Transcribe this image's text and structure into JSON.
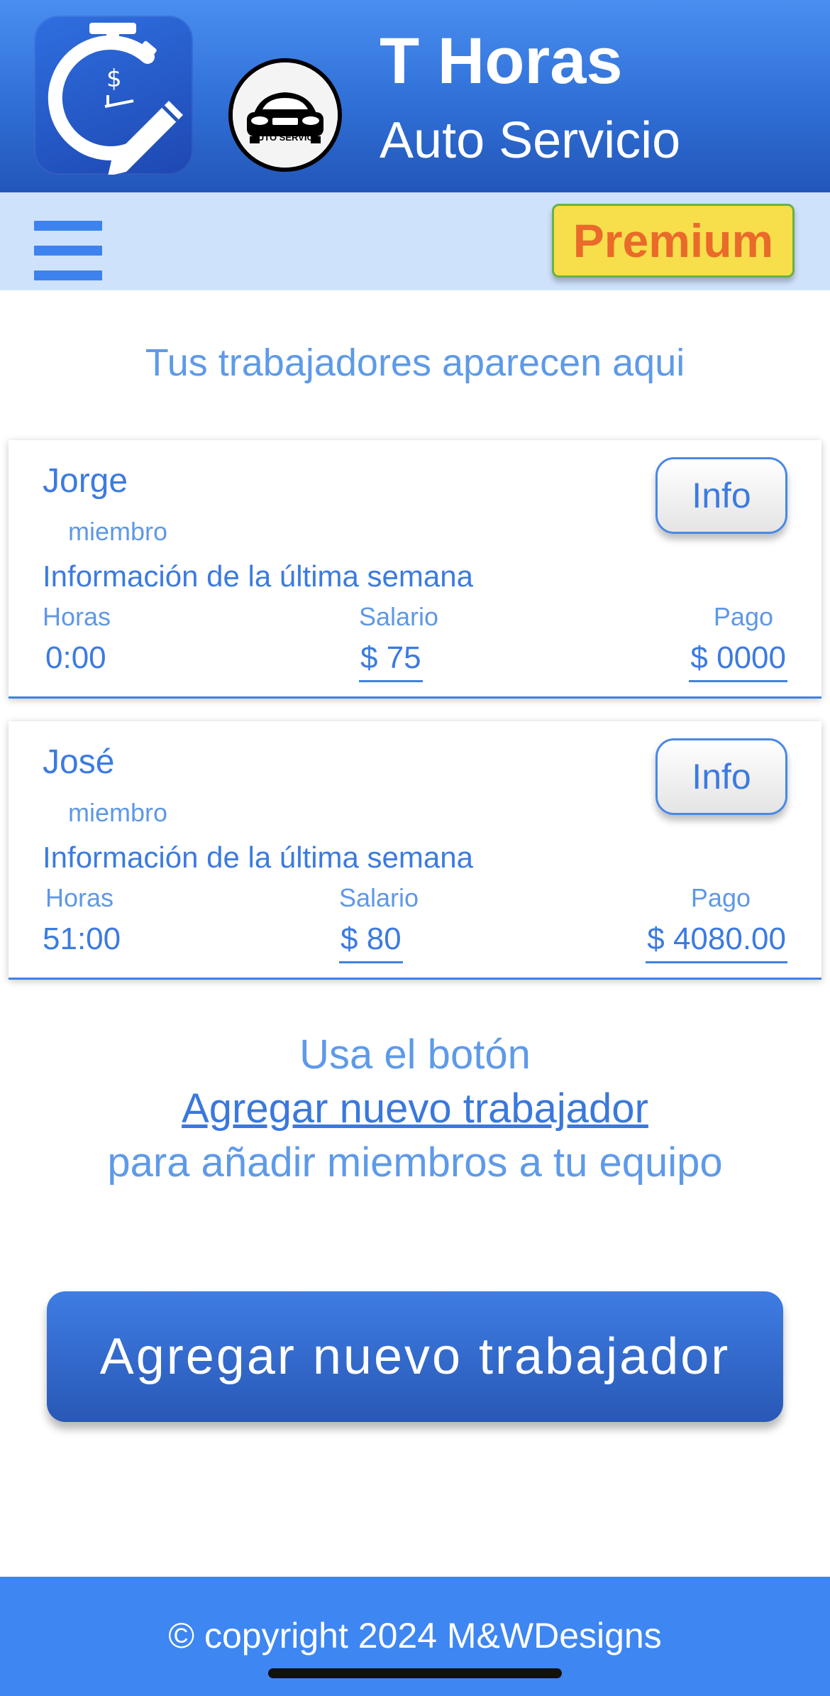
{
  "header": {
    "title": "T Horas",
    "subtitle": "Auto Servicio",
    "app_icon": "stopwatch-pencil-icon",
    "logo": "auto-service-car-logo",
    "logo_text": "AUTO SERVICE"
  },
  "toolbar": {
    "menu_icon": "hamburger-menu-icon",
    "premium_label": "Premium"
  },
  "intro_text": "Tus trabajadores aparecen aqui",
  "labels": {
    "week": "Información de la última semana",
    "hours": "Horas",
    "salary": "Salario",
    "payment": "Pago",
    "info": "Info"
  },
  "workers": [
    {
      "name": "Jorge",
      "role": "miembro",
      "hours": "0:00",
      "salary": "$ 75",
      "payment": "$ 0000"
    },
    {
      "name": "José",
      "role": "miembro",
      "hours": "51:00",
      "salary": "$ 80",
      "payment": "$ 4080.00"
    }
  ],
  "help": {
    "line1": "Usa el botón",
    "link": "Agregar nuevo trabajador",
    "line3": "para añadir miembros a tu equipo"
  },
  "add_button_label": "Agregar nuevo trabajador",
  "footer": {
    "copyright": "© copyright 2024 M&WDesigns"
  },
  "colors": {
    "header_blue": "#2f6fd6",
    "toolbar_bg": "#cfe2fb",
    "accent": "#3c7be0",
    "premium_bg": "#f7de4b",
    "premium_text": "#e96a2a",
    "footer_blue": "#3e86f2"
  }
}
